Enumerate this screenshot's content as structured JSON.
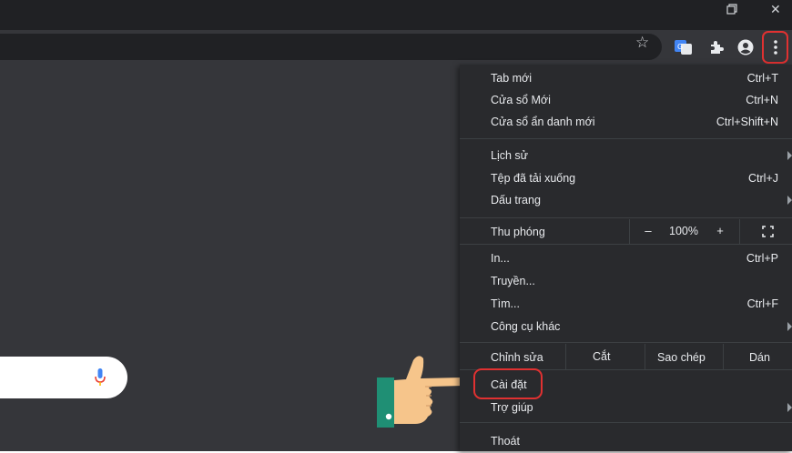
{
  "window_controls": {
    "restore_icon": "restore-icon",
    "close_symbol": "✕"
  },
  "toolbar": {
    "star": "☆",
    "extension_icon_1": "translate-icon",
    "extension_icon_2": "puzzle-icon",
    "profile_icon": "profile-icon",
    "menu_icon": "kebab-menu-icon"
  },
  "menu": {
    "new_tab": {
      "label": "Tab mới",
      "shortcut": "Ctrl+T"
    },
    "new_window": {
      "label": "Cửa sổ Mới",
      "shortcut": "Ctrl+N"
    },
    "incognito": {
      "label": "Cửa sổ ẩn danh mới",
      "shortcut": "Ctrl+Shift+N"
    },
    "history": {
      "label": "Lịch sử"
    },
    "downloads": {
      "label": "Tệp đã tải xuống",
      "shortcut": "Ctrl+J"
    },
    "bookmarks": {
      "label": "Dấu trang"
    },
    "zoom": {
      "label": "Thu phóng",
      "minus": "–",
      "value": "100%",
      "plus": "+"
    },
    "print": {
      "label": "In...",
      "shortcut": "Ctrl+P"
    },
    "cast": {
      "label": "Truyền..."
    },
    "find": {
      "label": "Tìm...",
      "shortcut": "Ctrl+F"
    },
    "more_tools": {
      "label": "Công cụ khác"
    },
    "edit": {
      "label": "Chỉnh sửa",
      "cut": "Cắt",
      "copy": "Sao chép",
      "paste": "Dán"
    },
    "settings": {
      "label": "Cài đặt"
    },
    "help": {
      "label": "Trợ giúp"
    },
    "exit": {
      "label": "Thoát"
    }
  },
  "colors": {
    "highlight": "#e03131",
    "menu_bg": "#292a2d",
    "toolbar_bg": "#35363a"
  }
}
